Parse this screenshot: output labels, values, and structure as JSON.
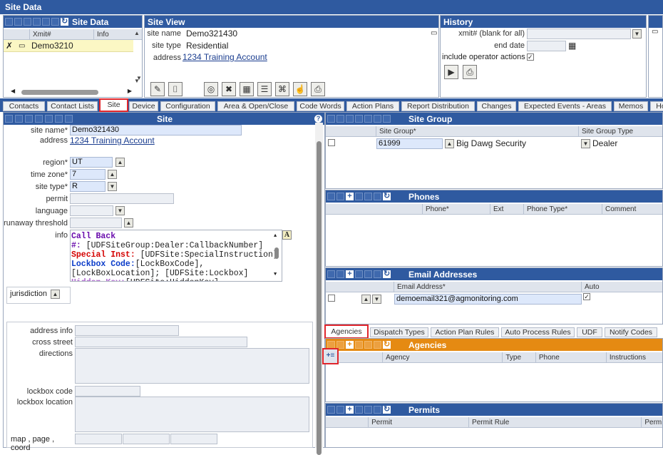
{
  "window_title": "Site Data",
  "site_data": {
    "title": "Site Data",
    "col_xmit": "Xmit#",
    "col_info": "Info",
    "row_value": "Demo3210"
  },
  "site_view": {
    "title": "Site View",
    "site_name_label": "site name",
    "site_name": "Demo321430",
    "site_type_label": "site type",
    "site_type": "Residential",
    "address_label": "address",
    "address": "1234 Training Account"
  },
  "history": {
    "title": "History",
    "xmit_label": "xmit#  (blank for all)",
    "end_date_label": "end date",
    "include_label": "include operator actions"
  },
  "tabs": [
    "Contacts",
    "Contact Lists",
    "Site",
    "Device",
    "Configuration",
    "Area & Open/Close",
    "Code Words",
    "Action Plans",
    "Report Distribution",
    "Changes",
    "Expected Events - Areas",
    "Memos",
    "Ho"
  ],
  "site": {
    "title": "Site",
    "site_name_label": "site name*",
    "site_name": "Demo321430",
    "address_label": "address",
    "address": "1234 Training Account",
    "region_label": "region*",
    "region": "UT",
    "timezone_label": "time zone*",
    "timezone": "7",
    "sitetype_label": "site type*",
    "sitetype": "R",
    "permit_label": "permit",
    "language_label": "language",
    "runaway_label": "runaway threshold",
    "info_label": "info",
    "info_lines": [
      {
        "head": "Call Back",
        "color": "#6a0dad",
        "rest": ""
      },
      {
        "head": "#:",
        "color": "#6a0dad",
        "rest": " [UDFSiteGroup:Dealer:CallbackNumber]"
      },
      {
        "head": "Special Inst:",
        "color": "#d40000",
        "rest": " [UDFSite:SpecialInstruction]"
      },
      {
        "head": "Lockbox Code:",
        "color": "#0b3cc9",
        "rest": "[LockBoxCode],"
      },
      {
        "head": "",
        "color": "#222",
        "rest": "[LockBoxLocation]; [UDFSite:Lockbox]"
      },
      {
        "head": "Hidden Key:",
        "color": "#b06ad0",
        "rest": "[UDFSite:HiddenKey]"
      }
    ],
    "jurisdiction_label": "jurisdiction",
    "address_info_label": "address info",
    "cross_street_label": "cross street",
    "directions_label": "directions",
    "lockbox_code_label": "lockbox code",
    "lockbox_location_label": "lockbox location",
    "map_label": "map ,  page ,",
    "coord_label": "coord"
  },
  "site_group": {
    "title": "Site Group",
    "col1": "Site Group*",
    "col2": "Site Group Type",
    "group": "61999",
    "name": "Big Dawg Security",
    "type": "Dealer"
  },
  "phones": {
    "title": "Phones",
    "cols": [
      "Phone*",
      "Ext",
      "Phone Type*",
      "Comment"
    ]
  },
  "email": {
    "title": "Email Addresses",
    "col1": "Email Address*",
    "col2": "Auto",
    "email": "demoemail321@agmonitoring.com"
  },
  "tabs2": [
    "Agencies",
    "Dispatch Types",
    "Action Plan Rules",
    "Auto Process Rules",
    "UDF",
    "Notify Codes"
  ],
  "agencies": {
    "title": "Agencies",
    "cols": [
      "Agency",
      "Type",
      "Phone",
      "Instructions"
    ]
  },
  "permits": {
    "title": "Permits",
    "cols": [
      "Permit",
      "Permit Rule",
      "Perm"
    ]
  },
  "colors": {
    "header_blue": "#2f5aa0",
    "agencies_orange": "#e58a12",
    "highlight_red": "#e0262c",
    "selected_row": "#fbf7c4",
    "input_blue": "#dde8fb"
  }
}
